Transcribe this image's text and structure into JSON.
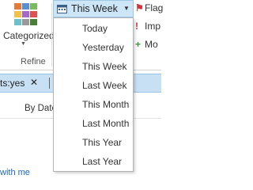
{
  "ribbon": {
    "categorized_label": "Categorized",
    "refine_label": "Refine",
    "this_week_label": "This Week",
    "right_items": [
      {
        "icon": "flag-icon",
        "label": "Flag"
      },
      {
        "icon": "important-icon",
        "label": "Imp"
      },
      {
        "icon": "plus-icon",
        "label": "Mo"
      }
    ]
  },
  "search": {
    "text": "ts:yes",
    "clear_label": "✕"
  },
  "list": {
    "sort_label": "By Date",
    "shared_link": "with me"
  },
  "dropdown": {
    "items": [
      "Today",
      "Yesterday",
      "This Week",
      "Last Week",
      "This Month",
      "Last Month",
      "This Year",
      "Last Year"
    ]
  },
  "colors": {
    "accent": "#cde6f7",
    "link": "#1e66b5"
  }
}
